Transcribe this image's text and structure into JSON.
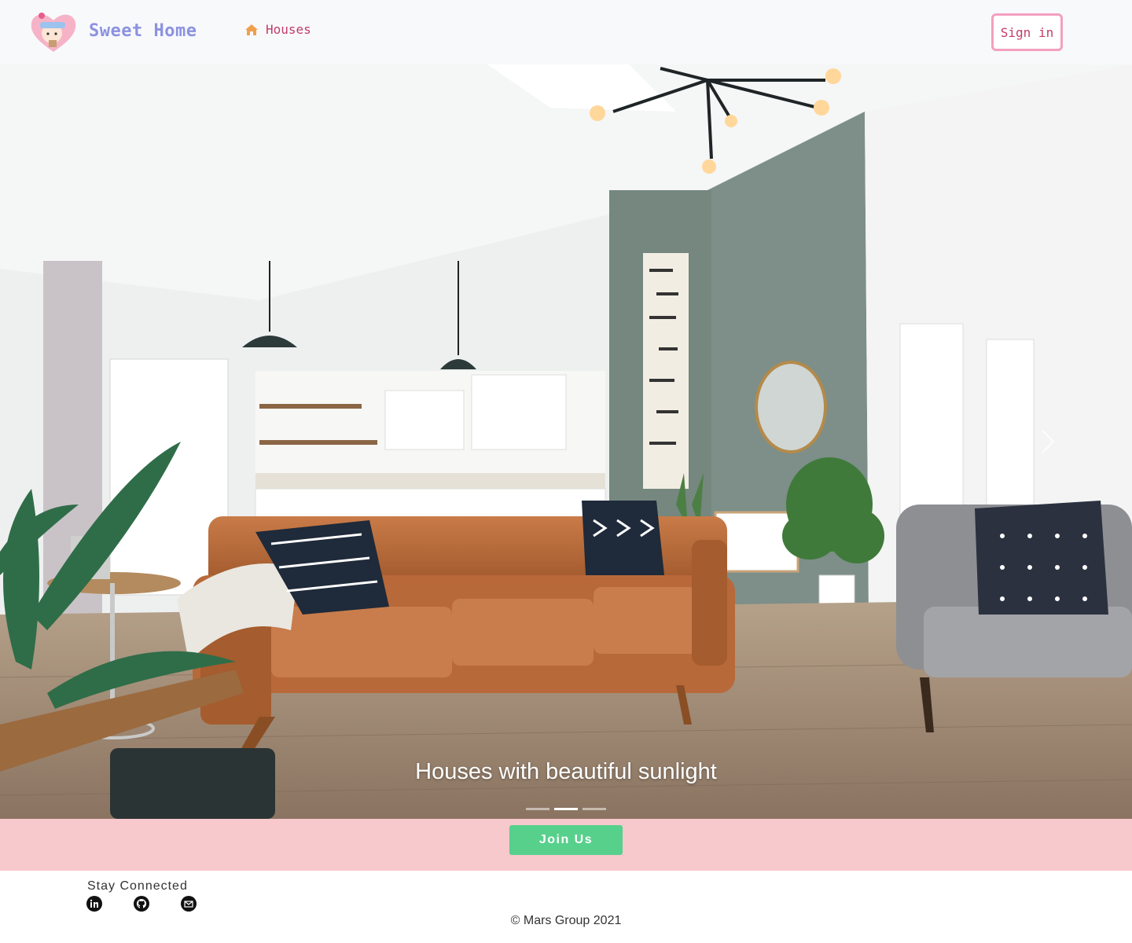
{
  "navbar": {
    "brand": "Sweet Home",
    "nav_link": "Houses",
    "sign_in": "Sign in"
  },
  "hero": {
    "caption": "Houses with beautiful sunlight",
    "slide_count": 3,
    "active_slide": 2
  },
  "join": {
    "label": "Join Us"
  },
  "footer": {
    "stay_connected": "Stay Connected",
    "social": [
      "linkedin-icon",
      "github-icon",
      "email-icon"
    ],
    "copyright": "© Mars Group 2021"
  },
  "colors": {
    "brand": "#8b92e0",
    "link": "#c23c6a",
    "sign_in_border": "#f3a0bf",
    "join_band": "#f7c8cc",
    "join_button": "#57d08c",
    "house_icon": "#f0a04b"
  }
}
